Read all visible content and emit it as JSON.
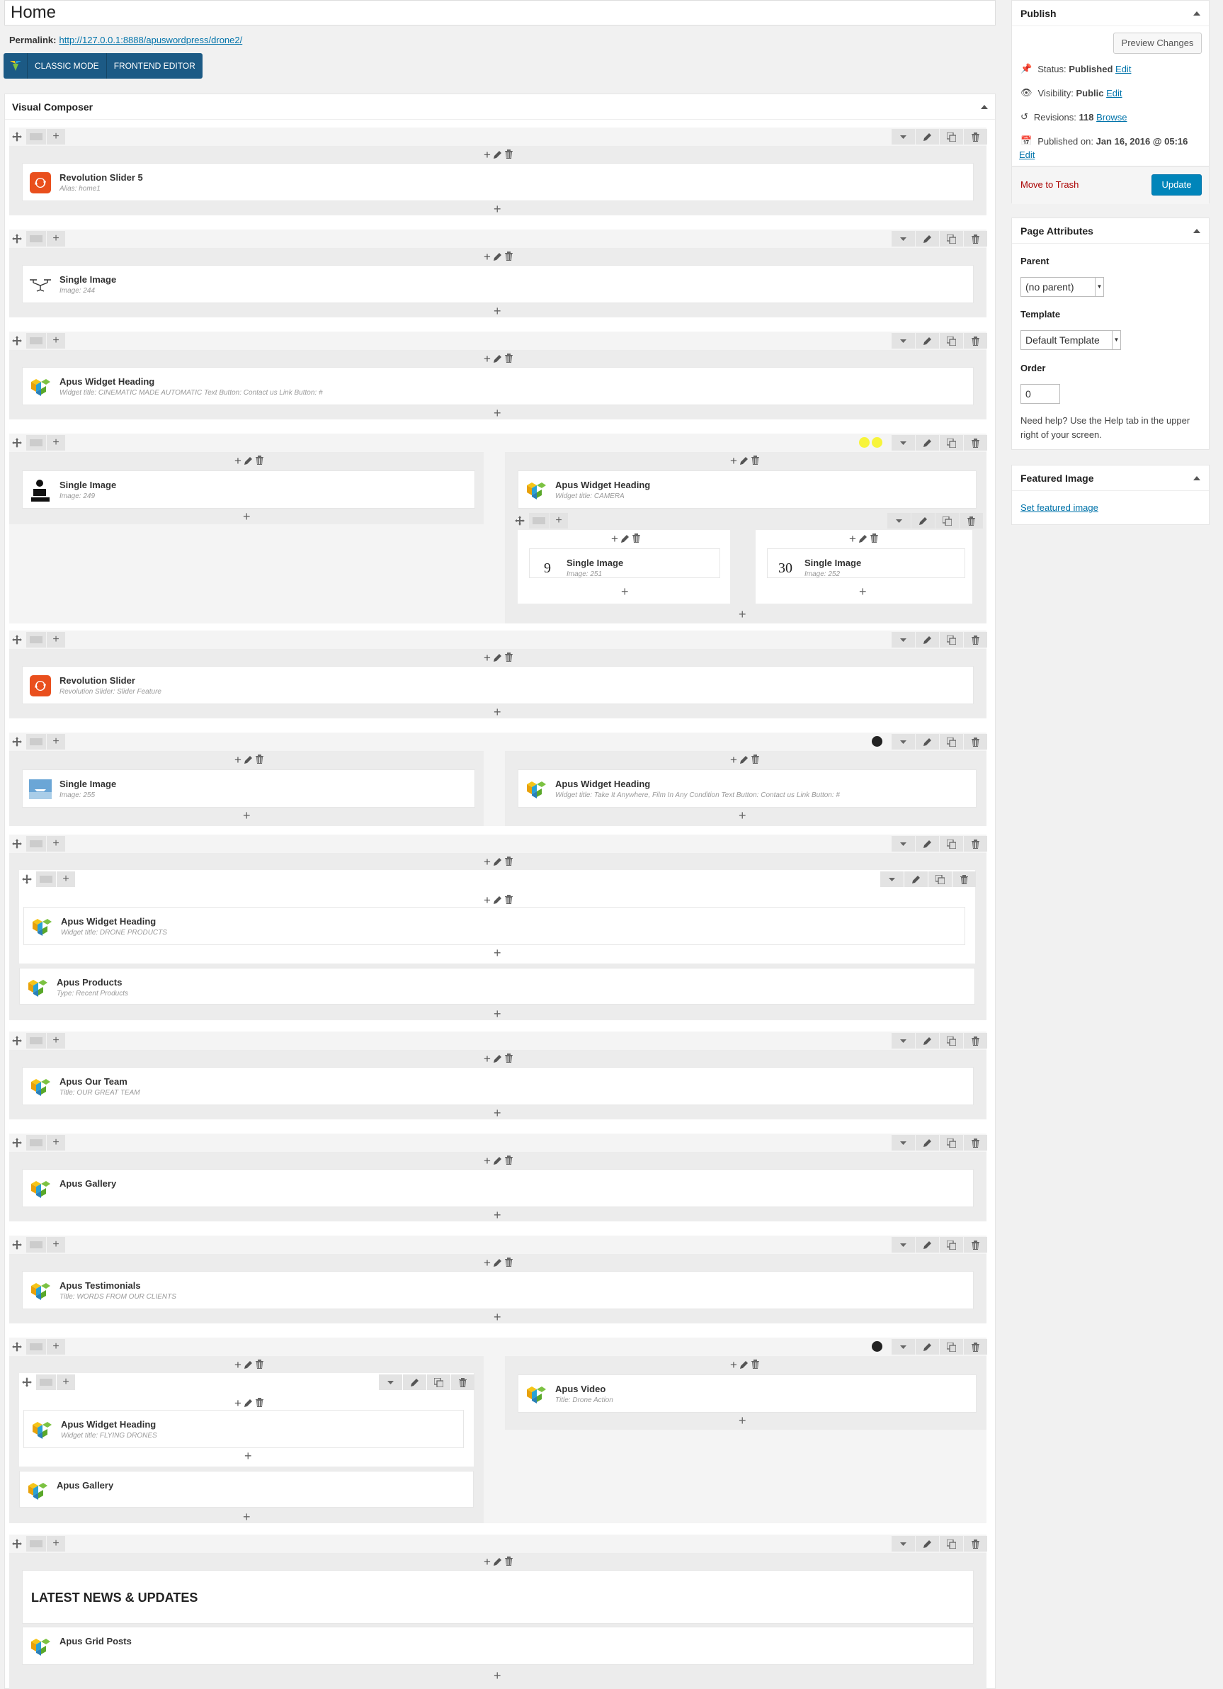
{
  "title": "Home",
  "permalink": {
    "label": "Permalink:",
    "url": "http://127.0.0.1:8888/apuswordpress/drone2/"
  },
  "vc_switch": {
    "classic": "CLASSIC MODE",
    "frontend": "FRONTEND EDITOR"
  },
  "vc_panel_title": "Visual Composer",
  "elements": {
    "rev_slider_5": {
      "name": "Revolution Slider 5",
      "sub": "Alias: home1"
    },
    "single_image_244": {
      "name": "Single Image",
      "sub": "Image: 244"
    },
    "heading_cinematic": {
      "name": "Apus Widget Heading",
      "sub": "Widget title: CINEMATIC MADE AUTOMATIC  Text Button: Contact us   Link Button: #"
    },
    "single_image_249": {
      "name": "Single Image",
      "sub": "Image: 249"
    },
    "heading_camera": {
      "name": "Apus Widget Heading",
      "sub": "Widget title: CAMERA"
    },
    "single_image_251": {
      "name": "Single Image",
      "sub": "Image: 251"
    },
    "single_image_252": {
      "name": "Single Image",
      "sub": "Image: 252"
    },
    "rev_slider_feature": {
      "name": "Revolution Slider",
      "sub": "Revolution Slider: Slider Feature"
    },
    "single_image_255": {
      "name": "Single Image",
      "sub": "Image: 255"
    },
    "heading_anywhere": {
      "name": "Apus Widget Heading",
      "sub": "Widget title: Take It Anywhere, Film In Any Condition  Text Button: Contact us   Link Button: #"
    },
    "heading_drone_products": {
      "name": "Apus Widget Heading",
      "sub": "Widget title: DRONE PRODUCTS"
    },
    "products": {
      "name": "Apus Products",
      "sub": "Type: Recent Products"
    },
    "our_team": {
      "name": "Apus Our Team",
      "sub": "Title: OUR GREAT TEAM"
    },
    "gallery_1": {
      "name": "Apus Gallery",
      "sub": ""
    },
    "testimonials": {
      "name": "Apus Testimonials",
      "sub": "Title: WORDS FROM OUR CLIENTS"
    },
    "heading_flying": {
      "name": "Apus Widget Heading",
      "sub": "Widget title: FLYING DRONES"
    },
    "gallery_2": {
      "name": "Apus Gallery",
      "sub": ""
    },
    "video": {
      "name": "Apus Video",
      "sub": "Title: Drone Action"
    },
    "latest_news": {
      "text": "LATEST NEWS & UPDATES"
    },
    "grid_posts": {
      "name": "Apus Grid Posts",
      "sub": ""
    }
  },
  "thumb_text": {
    "img251": "9",
    "img252": "30"
  },
  "publish": {
    "title": "Publish",
    "preview_label": "Preview Changes",
    "status_label": "Status:",
    "status_value": "Published",
    "status_edit": "Edit",
    "visibility_label": "Visibility:",
    "visibility_value": "Public",
    "visibility_edit": "Edit",
    "revisions_label": "Revisions:",
    "revisions_value": "118",
    "revisions_browse": "Browse",
    "published_label": "Published on:",
    "published_value": "Jan 16, 2016 @ 05:16",
    "published_edit": "Edit",
    "trash_label": "Move to Trash",
    "update_label": "Update"
  },
  "page_attributes": {
    "title": "Page Attributes",
    "parent_label": "Parent",
    "parent_value": "(no parent)",
    "template_label": "Template",
    "template_value": "Default Template",
    "order_label": "Order",
    "order_value": "0",
    "help_text": "Need help? Use the Help tab in the upper right of your screen."
  },
  "featured_image": {
    "title": "Featured Image",
    "link": "Set featured image"
  },
  "colors": {
    "accent": "#0073aa",
    "vc_blue": "#1c5a85",
    "update_btn": "#0085ba",
    "trash": "#a00",
    "yellow_dot": "#f7f43a",
    "dark_dot": "#222222"
  }
}
